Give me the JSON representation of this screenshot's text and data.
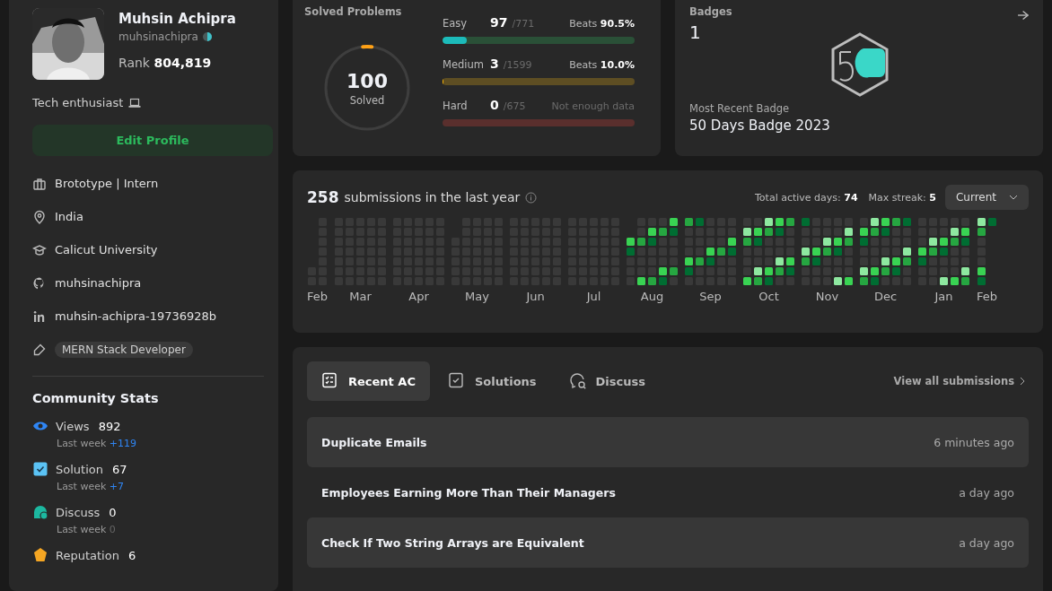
{
  "profile": {
    "name": "Muhsin Achipra",
    "username": "muhsinachipra",
    "rank_label": "Rank",
    "rank": "804,819",
    "bio": "Tech enthusiast",
    "edit_button": "Edit Profile",
    "details": [
      {
        "kind": "work",
        "text": "Brototype | Intern"
      },
      {
        "kind": "location",
        "text": "India"
      },
      {
        "kind": "school",
        "text": "Calicut University"
      },
      {
        "kind": "github",
        "text": "muhsinachipra"
      },
      {
        "kind": "linkedin",
        "text": "muhsin-achipra-19736928b"
      },
      {
        "kind": "skill",
        "text": "MERN Stack Developer"
      }
    ]
  },
  "community_stats": {
    "title": "Community Stats",
    "items": [
      {
        "kind": "views",
        "label": "Views",
        "value": "892",
        "week_label": "Last week",
        "change": "+119",
        "positive": true
      },
      {
        "kind": "solution",
        "label": "Solution",
        "value": "67",
        "week_label": "Last week",
        "change": "+7",
        "positive": true
      },
      {
        "kind": "discuss",
        "label": "Discuss",
        "value": "0",
        "week_label": "Last week",
        "change": "0",
        "positive": false
      },
      {
        "kind": "reputation",
        "label": "Reputation",
        "value": "6"
      }
    ]
  },
  "solved": {
    "title": "Solved Problems",
    "total": "100",
    "total_label": "Solved",
    "level": 0.035,
    "difficulties": [
      {
        "kind": "easy",
        "label": "Easy",
        "solved": "97",
        "total": "/771",
        "beats_label": "Beats",
        "beats": "90.5%",
        "level": 0.126
      },
      {
        "kind": "medium",
        "label": "Medium",
        "solved": "3",
        "total": "/1599",
        "beats_label": "Beats",
        "beats": "10.0%",
        "level": 0.003
      },
      {
        "kind": "hard",
        "label": "Hard",
        "solved": "0",
        "total": "/675",
        "note": "Not enough data",
        "level": 0
      }
    ]
  },
  "badges": {
    "title": "Badges",
    "count": "1",
    "recent_label": "Most Recent Badge",
    "recent_name": "50 Days Badge 2023"
  },
  "activity": {
    "count": "258",
    "text": "submissions in the last year",
    "active_label": "Total active days:",
    "active": "74",
    "streak_label": "Max streak:",
    "streak": "5",
    "dropdown": "Current",
    "months": [
      "Feb",
      "Mar",
      "Apr",
      "May",
      "Jun",
      "Jul",
      "Aug",
      "Sep",
      "Oct",
      "Nov",
      "Dec",
      "Jan",
      "Feb"
    ]
  },
  "tabs": [
    {
      "kind": "recent",
      "label": "Recent AC",
      "selected": true
    },
    {
      "kind": "solutions",
      "label": "Solutions",
      "selected": false
    },
    {
      "kind": "discuss",
      "label": "Discuss",
      "selected": false
    }
  ],
  "view_all": "View all submissions",
  "submissions": [
    {
      "title": "Duplicate Emails",
      "time": "6 minutes ago"
    },
    {
      "title": "Employees Earning More Than Their Managers",
      "time": "a day ago"
    },
    {
      "title": "Check If Two String Arrays are Equivalent",
      "time": "a day ago"
    }
  ]
}
